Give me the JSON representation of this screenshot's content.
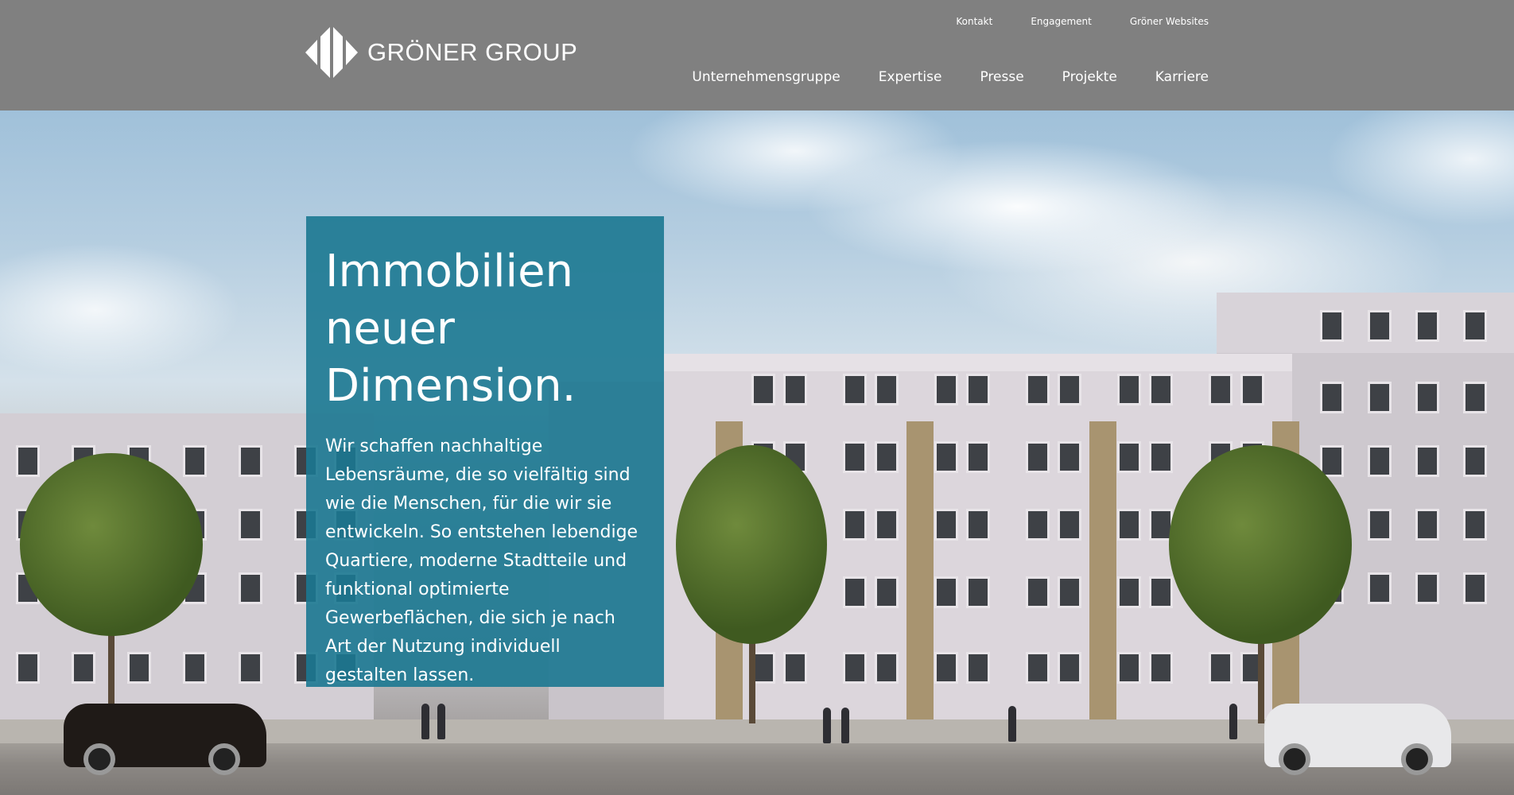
{
  "brand": {
    "logo_text": "GRÖNER GROUP"
  },
  "top_nav": [
    "Kontakt",
    "Engagement",
    "Gröner Websites"
  ],
  "main_nav": [
    "Unternehmensgruppe",
    "Expertise",
    "Presse",
    "Projekte",
    "Karriere"
  ],
  "hero": {
    "headline": "Immobilien neuer Dimension.",
    "body": "Wir schaffen nachhaltige Lebensräume, die so vielfältig sind wie die Menschen, für die wir sie entwickeln. So entstehen lebendige Quartiere, moderne Stadtteile und funktional optimierte Gewerbeflächen, die sich je nach Art der Nutzung individuell gestalten lassen."
  },
  "colors": {
    "header_bg": "#808080",
    "hero_box": "#1b7891"
  }
}
